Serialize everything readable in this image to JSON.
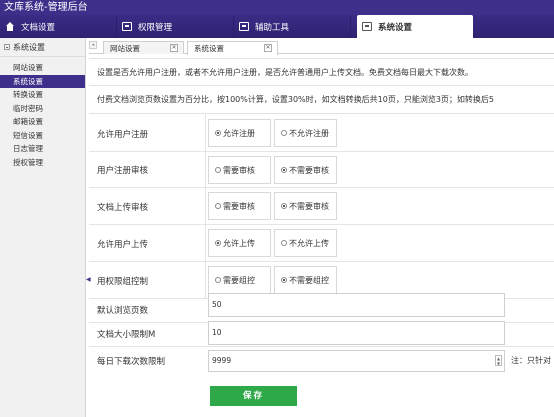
{
  "app": {
    "title": "文库系统-管理后台"
  },
  "nav": {
    "tabs": [
      {
        "label": "文档设置",
        "icon": "home-icon"
      },
      {
        "label": "权限管理",
        "icon": "users-icon"
      },
      {
        "label": "辅助工具",
        "icon": "tools-icon"
      },
      {
        "label": "系统设置",
        "icon": "settings-icon",
        "active": true
      }
    ]
  },
  "sidebar": {
    "header": "系统设置",
    "items": [
      {
        "label": "网站设置"
      },
      {
        "label": "系统设置",
        "active": true
      },
      {
        "label": "转换设置"
      },
      {
        "label": "临时密码"
      },
      {
        "label": "邮箱设置"
      },
      {
        "label": "短信设置"
      },
      {
        "label": "日志管理"
      },
      {
        "label": "授权管理"
      }
    ]
  },
  "content_tabs": [
    {
      "label": "网站设置"
    },
    {
      "label": "系统设置",
      "active": true
    }
  ],
  "notices": {
    "line1": "设置是否允许用户注册，或者不允许用户注册，是否允许普通用户上传文档。免费文档每日最大下载次数。",
    "line2": "付费文档浏览页数设置为百分比，按100%计算，设置30%时，如文档转换后共10页，只能浏览3页；如转换后5"
  },
  "settings": {
    "allow_register": {
      "label": "允许用户注册",
      "opt1": "允许注册",
      "opt2": "不允许注册",
      "selected": 1
    },
    "register_review": {
      "label": "用户注册审核",
      "opt1": "需要审核",
      "opt2": "不需要审核",
      "selected": 2
    },
    "upload_review": {
      "label": "文档上传审核",
      "opt1": "需要审核",
      "opt2": "不需要审核",
      "selected": 2
    },
    "allow_upload": {
      "label": "允许用户上传",
      "opt1": "允许上传",
      "opt2": "不允许上传",
      "selected": 1
    },
    "group_control": {
      "label": "用权限组控制",
      "opt1": "需要组控",
      "opt2": "不需要组控",
      "selected": 2
    },
    "default_pages": {
      "label": "默认浏览页数",
      "value": "50"
    },
    "size_limit": {
      "label": "文档大小限制M",
      "value": "10"
    },
    "daily_download": {
      "label": "每日下载次数限制",
      "value": "9999",
      "note": "注：只针对"
    }
  },
  "actions": {
    "save": "保存"
  },
  "colors": {
    "header": "#3d2f8a",
    "save_button": "#2fa84a"
  }
}
